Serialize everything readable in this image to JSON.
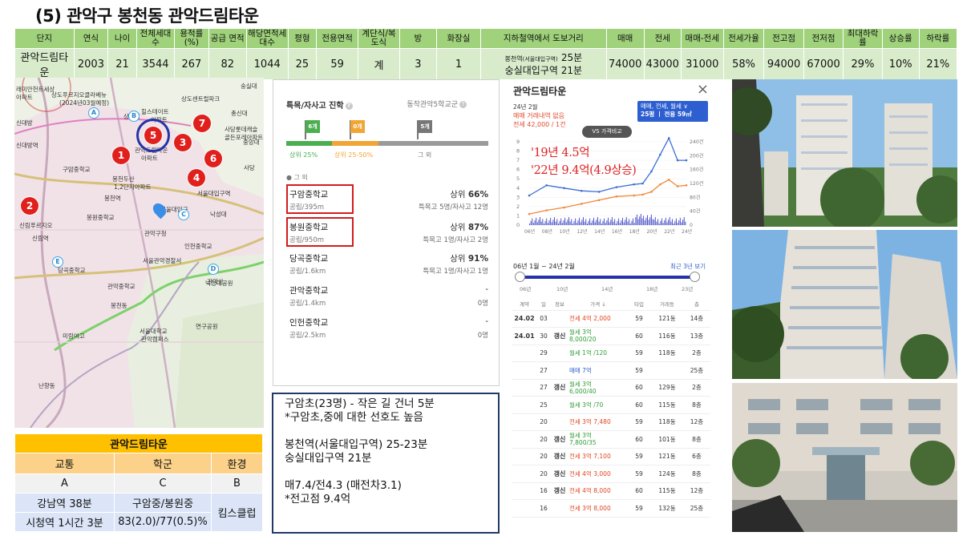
{
  "title": "(5) 관악구 봉천동 관악드림타운",
  "summary": {
    "headers": [
      "단지",
      "연식",
      "나이",
      "전체세대수",
      "용적률(%)",
      "공급 면적",
      "해당면적세대수",
      "평형",
      "전용면적",
      "계단식/복도식",
      "방",
      "화장실",
      "지하철역에서 도보거리",
      "매매",
      "전세",
      "매매-전세",
      "전세가율",
      "전고점",
      "전저점",
      "최대하락률",
      "상승률",
      "하락률"
    ],
    "values": [
      "관악드림타운",
      "2003",
      "21",
      "3544",
      "267",
      "82",
      "1044",
      "25",
      "59",
      "계",
      "3",
      "1",
      "",
      "74000",
      "43000",
      "31000",
      "58%",
      "94000",
      "67000",
      "29%",
      "10%",
      "21%"
    ],
    "subway_line1_prefix": "봉천역",
    "subway_line1_small": "(서울대입구역)",
    "subway_line1_time": "25분",
    "subway_line2": "숭실대입구역 21분"
  },
  "map": {
    "labels": [
      "래미안헌트세상",
      "아파트",
      "상도푸르지오클라베뉴",
      "(2024년03월예정)",
      "힐스테이트",
      "상도센트럴파크",
      "아파트",
      "상도역",
      "신대방",
      "숭실대",
      "사당롯데캐슬",
      "골든포레아파트",
      "중앙대",
      "신대방역",
      "관악드림타운",
      "아파트",
      "봉천두산",
      "1,2단지아파트",
      "봉천역",
      "서울대입구역",
      "관악구청",
      "신림푸르지오",
      "신림역",
      "서울관악경찰서",
      "관악산",
      "서울대학교",
      "관악캠퍼스",
      "낙성대공원",
      "연구공원",
      "봉천동",
      "난향동",
      "미림여고",
      "구암중학교",
      "봉원중학교",
      "당곡중학교",
      "관악중학교",
      "인헌중학교",
      "사당",
      "총신대",
      "서울대입구",
      "낙성대"
    ],
    "markers": [
      "1",
      "2",
      "3",
      "4",
      "5",
      "6",
      "7"
    ],
    "pins": [
      "A",
      "B",
      "C",
      "D",
      "E"
    ]
  },
  "info_table": {
    "title": "관악드림타운",
    "headers": [
      "교통",
      "학군",
      "환경"
    ],
    "row1": [
      "A",
      "C",
      "B"
    ],
    "row2": [
      "강남역 38분",
      "구암중/봉원중"
    ],
    "row3": [
      "시청역 1시간 3분",
      "83(2.0)/77(0.5)%"
    ],
    "env": "킴스클럽"
  },
  "school": {
    "header": "특목/자사고 진학",
    "header_right": "동작관악5학교군",
    "flags": [
      "6개",
      "0개",
      "5개"
    ],
    "bar_labels": [
      "상위 25%",
      "상위 25-50%",
      "그 외"
    ],
    "legend": "● 그 외",
    "rows": [
      {
        "name": "구암중학교",
        "dist": "공립/395m",
        "rank_prefix": "상위 ",
        "rank": "66%",
        "stat": "특목고 5명/자사고 12명"
      },
      {
        "name": "봉원중학교",
        "dist": "공립/950m",
        "rank_prefix": "상위 ",
        "rank": "87%",
        "stat": "특목고 1명/자사고 2명"
      },
      {
        "name": "당곡중학교",
        "dist": "공립/1.6km",
        "rank_prefix": "상위 ",
        "rank": "91%",
        "stat": "특목고 1명/자사고 1명"
      },
      {
        "name": "관악중학교",
        "dist": "공립/1.4km",
        "rank_prefix": "",
        "rank": "-",
        "stat": "0명"
      },
      {
        "name": "인헌중학교",
        "dist": "공립/2.5km",
        "rank_prefix": "",
        "rank": "-",
        "stat": "0명"
      }
    ]
  },
  "notes": {
    "lines": [
      "구암초(23명) - 작은 길 건너 5분",
      "*구암초,중에 대한 선호도 높음",
      "",
      "봉천역(서울대입구역) 25-23분",
      "숭실대입구역 21분",
      "",
      "매7.4/전4.3 (매전차3.1)",
      " *전고점 9.4억"
    ]
  },
  "price": {
    "title": "관악드림타운",
    "close": "×",
    "date": "24년 2월",
    "trade_none": "매매 거래내역 없음",
    "jeonse": "전세 42,000 / 1건",
    "selector_line1": "매매, 전세, 월세 ∨",
    "selector_line2": "25평 ㅣ 전용 59㎡",
    "vs": "VS 가격비교",
    "annotation1": "'19년 4.5억",
    "annotation2": "'22년 9.4억(4.9상승)",
    "range": "06년 1월 ~ 24년 2월",
    "recent": "최근 3년 보기",
    "slider_ticks": [
      "06년",
      "10년",
      "14년",
      "18년",
      "23년"
    ],
    "headers": [
      "계약",
      "일",
      "정보",
      "가격 ↓",
      "타입",
      "거래동",
      "층"
    ],
    "rows": [
      [
        "24.02",
        "03",
        "",
        "전세 4억 2,000",
        "",
        "59",
        "121동",
        "14층"
      ],
      [
        "24.01",
        "30",
        "갱신",
        "월세 3억",
        "8,000/20",
        "60",
        "116동",
        "13층"
      ],
      [
        "",
        "29",
        "",
        "월세 1억 /120",
        "",
        "59",
        "118동",
        "2층"
      ],
      [
        "",
        "27",
        "",
        "매매 7억",
        "",
        "59",
        "",
        "25층"
      ],
      [
        "",
        "27",
        "갱신",
        "월세 3억",
        "6,000/40",
        "60",
        "129동",
        "2층"
      ],
      [
        "",
        "25",
        "",
        "월세 3억 /70",
        "",
        "60",
        "115동",
        "8층"
      ],
      [
        "",
        "20",
        "",
        "전세 3억 7,480",
        "",
        "59",
        "118동",
        "12층"
      ],
      [
        "",
        "20",
        "갱신",
        "월세 3억",
        "7,800/35",
        "60",
        "101동",
        "8층"
      ],
      [
        "",
        "20",
        "갱신",
        "전세 3억 7,100",
        "",
        "59",
        "121동",
        "6층"
      ],
      [
        "",
        "20",
        "갱신",
        "전세 4억 3,000",
        "",
        "59",
        "124동",
        "8층"
      ],
      [
        "",
        "16",
        "갱신",
        "전세 4억 8,000",
        "",
        "60",
        "115동",
        "12층"
      ],
      [
        "",
        "16",
        "",
        "전세 3억 8,000",
        "",
        "59",
        "132동",
        "25층"
      ]
    ],
    "left_ticks": [
      "9",
      "8",
      "7",
      "6",
      "5",
      "4",
      "3",
      "2",
      "1",
      "0"
    ],
    "right_ticks": [
      "240건",
      "200건",
      "160건",
      "120건",
      "80건",
      "40건",
      "0"
    ],
    "x_ticks": [
      "06년",
      "08년",
      "10년",
      "12년",
      "14년",
      "16년",
      "18년",
      "20년",
      "22년",
      "24년"
    ]
  },
  "chart_data": {
    "type": "line",
    "x": [
      2006,
      2008,
      2010,
      2012,
      2014,
      2016,
      2018,
      2019,
      2020,
      2021,
      2022,
      2023,
      2024
    ],
    "series": [
      {
        "name": "매매",
        "values": [
          3.2,
          4.3,
          4.0,
          3.7,
          3.6,
          4.1,
          4.4,
          4.5,
          5.8,
          7.6,
          9.4,
          7.0,
          7.0
        ]
      },
      {
        "name": "전세",
        "values": [
          1.2,
          1.6,
          1.9,
          2.3,
          2.7,
          3.1,
          3.2,
          3.3,
          3.6,
          4.4,
          4.9,
          4.2,
          4.3
        ]
      }
    ],
    "ylim": [
      0,
      9
    ],
    "color_trade": "#3c6fd6",
    "color_jeonse": "#f0883a",
    "color_volume": "#4f57c8"
  },
  "colors": {
    "table_header": "#9fd27b",
    "table_row": "#d8eccb",
    "info_title": "#ffc000",
    "info_header": "#fcd28a",
    "notes_border": "#1f3a66",
    "marker_red": "#e0201c",
    "highlight_ring": "#2433a8"
  }
}
